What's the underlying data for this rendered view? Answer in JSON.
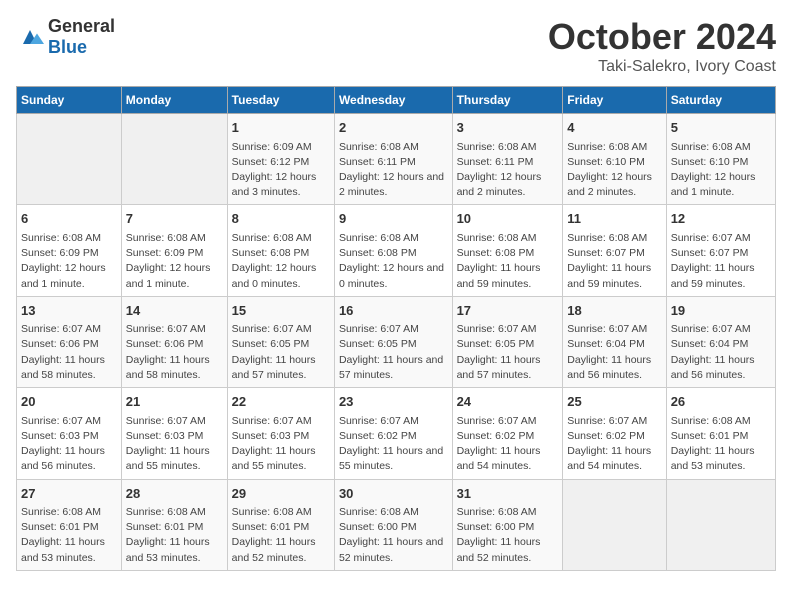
{
  "logo": {
    "general": "General",
    "blue": "Blue"
  },
  "title": {
    "month": "October 2024",
    "location": "Taki-Salekro, Ivory Coast"
  },
  "weekdays": [
    "Sunday",
    "Monday",
    "Tuesday",
    "Wednesday",
    "Thursday",
    "Friday",
    "Saturday"
  ],
  "weeks": [
    [
      {
        "day": "",
        "sunrise": "",
        "sunset": "",
        "daylight": ""
      },
      {
        "day": "",
        "sunrise": "",
        "sunset": "",
        "daylight": ""
      },
      {
        "day": "1",
        "sunrise": "Sunrise: 6:09 AM",
        "sunset": "Sunset: 6:12 PM",
        "daylight": "Daylight: 12 hours and 3 minutes."
      },
      {
        "day": "2",
        "sunrise": "Sunrise: 6:08 AM",
        "sunset": "Sunset: 6:11 PM",
        "daylight": "Daylight: 12 hours and 2 minutes."
      },
      {
        "day": "3",
        "sunrise": "Sunrise: 6:08 AM",
        "sunset": "Sunset: 6:11 PM",
        "daylight": "Daylight: 12 hours and 2 minutes."
      },
      {
        "day": "4",
        "sunrise": "Sunrise: 6:08 AM",
        "sunset": "Sunset: 6:10 PM",
        "daylight": "Daylight: 12 hours and 2 minutes."
      },
      {
        "day": "5",
        "sunrise": "Sunrise: 6:08 AM",
        "sunset": "Sunset: 6:10 PM",
        "daylight": "Daylight: 12 hours and 1 minute."
      }
    ],
    [
      {
        "day": "6",
        "sunrise": "Sunrise: 6:08 AM",
        "sunset": "Sunset: 6:09 PM",
        "daylight": "Daylight: 12 hours and 1 minute."
      },
      {
        "day": "7",
        "sunrise": "Sunrise: 6:08 AM",
        "sunset": "Sunset: 6:09 PM",
        "daylight": "Daylight: 12 hours and 1 minute."
      },
      {
        "day": "8",
        "sunrise": "Sunrise: 6:08 AM",
        "sunset": "Sunset: 6:08 PM",
        "daylight": "Daylight: 12 hours and 0 minutes."
      },
      {
        "day": "9",
        "sunrise": "Sunrise: 6:08 AM",
        "sunset": "Sunset: 6:08 PM",
        "daylight": "Daylight: 12 hours and 0 minutes."
      },
      {
        "day": "10",
        "sunrise": "Sunrise: 6:08 AM",
        "sunset": "Sunset: 6:08 PM",
        "daylight": "Daylight: 11 hours and 59 minutes."
      },
      {
        "day": "11",
        "sunrise": "Sunrise: 6:08 AM",
        "sunset": "Sunset: 6:07 PM",
        "daylight": "Daylight: 11 hours and 59 minutes."
      },
      {
        "day": "12",
        "sunrise": "Sunrise: 6:07 AM",
        "sunset": "Sunset: 6:07 PM",
        "daylight": "Daylight: 11 hours and 59 minutes."
      }
    ],
    [
      {
        "day": "13",
        "sunrise": "Sunrise: 6:07 AM",
        "sunset": "Sunset: 6:06 PM",
        "daylight": "Daylight: 11 hours and 58 minutes."
      },
      {
        "day": "14",
        "sunrise": "Sunrise: 6:07 AM",
        "sunset": "Sunset: 6:06 PM",
        "daylight": "Daylight: 11 hours and 58 minutes."
      },
      {
        "day": "15",
        "sunrise": "Sunrise: 6:07 AM",
        "sunset": "Sunset: 6:05 PM",
        "daylight": "Daylight: 11 hours and 57 minutes."
      },
      {
        "day": "16",
        "sunrise": "Sunrise: 6:07 AM",
        "sunset": "Sunset: 6:05 PM",
        "daylight": "Daylight: 11 hours and 57 minutes."
      },
      {
        "day": "17",
        "sunrise": "Sunrise: 6:07 AM",
        "sunset": "Sunset: 6:05 PM",
        "daylight": "Daylight: 11 hours and 57 minutes."
      },
      {
        "day": "18",
        "sunrise": "Sunrise: 6:07 AM",
        "sunset": "Sunset: 6:04 PM",
        "daylight": "Daylight: 11 hours and 56 minutes."
      },
      {
        "day": "19",
        "sunrise": "Sunrise: 6:07 AM",
        "sunset": "Sunset: 6:04 PM",
        "daylight": "Daylight: 11 hours and 56 minutes."
      }
    ],
    [
      {
        "day": "20",
        "sunrise": "Sunrise: 6:07 AM",
        "sunset": "Sunset: 6:03 PM",
        "daylight": "Daylight: 11 hours and 56 minutes."
      },
      {
        "day": "21",
        "sunrise": "Sunrise: 6:07 AM",
        "sunset": "Sunset: 6:03 PM",
        "daylight": "Daylight: 11 hours and 55 minutes."
      },
      {
        "day": "22",
        "sunrise": "Sunrise: 6:07 AM",
        "sunset": "Sunset: 6:03 PM",
        "daylight": "Daylight: 11 hours and 55 minutes."
      },
      {
        "day": "23",
        "sunrise": "Sunrise: 6:07 AM",
        "sunset": "Sunset: 6:02 PM",
        "daylight": "Daylight: 11 hours and 55 minutes."
      },
      {
        "day": "24",
        "sunrise": "Sunrise: 6:07 AM",
        "sunset": "Sunset: 6:02 PM",
        "daylight": "Daylight: 11 hours and 54 minutes."
      },
      {
        "day": "25",
        "sunrise": "Sunrise: 6:07 AM",
        "sunset": "Sunset: 6:02 PM",
        "daylight": "Daylight: 11 hours and 54 minutes."
      },
      {
        "day": "26",
        "sunrise": "Sunrise: 6:08 AM",
        "sunset": "Sunset: 6:01 PM",
        "daylight": "Daylight: 11 hours and 53 minutes."
      }
    ],
    [
      {
        "day": "27",
        "sunrise": "Sunrise: 6:08 AM",
        "sunset": "Sunset: 6:01 PM",
        "daylight": "Daylight: 11 hours and 53 minutes."
      },
      {
        "day": "28",
        "sunrise": "Sunrise: 6:08 AM",
        "sunset": "Sunset: 6:01 PM",
        "daylight": "Daylight: 11 hours and 53 minutes."
      },
      {
        "day": "29",
        "sunrise": "Sunrise: 6:08 AM",
        "sunset": "Sunset: 6:01 PM",
        "daylight": "Daylight: 11 hours and 52 minutes."
      },
      {
        "day": "30",
        "sunrise": "Sunrise: 6:08 AM",
        "sunset": "Sunset: 6:00 PM",
        "daylight": "Daylight: 11 hours and 52 minutes."
      },
      {
        "day": "31",
        "sunrise": "Sunrise: 6:08 AM",
        "sunset": "Sunset: 6:00 PM",
        "daylight": "Daylight: 11 hours and 52 minutes."
      },
      {
        "day": "",
        "sunrise": "",
        "sunset": "",
        "daylight": ""
      },
      {
        "day": "",
        "sunrise": "",
        "sunset": "",
        "daylight": ""
      }
    ]
  ]
}
